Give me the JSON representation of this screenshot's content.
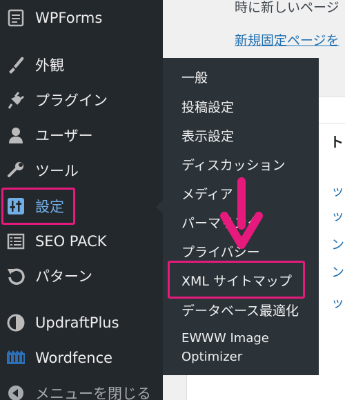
{
  "sidebar": {
    "items": [
      {
        "label": "WPForms",
        "icon": "wpforms-icon"
      },
      {
        "label": "外観",
        "icon": "paintbrush-icon"
      },
      {
        "label": "プラグイン",
        "icon": "plugin-icon"
      },
      {
        "label": "ユーザー",
        "icon": "user-icon"
      },
      {
        "label": "ツール",
        "icon": "wrench-icon"
      },
      {
        "label": "設定",
        "icon": "settings-icon"
      },
      {
        "label": "SEO PACK",
        "icon": "list-icon"
      },
      {
        "label": "パターン",
        "icon": "undo-icon"
      },
      {
        "label": "UpdraftPlus",
        "icon": "updraft-icon"
      },
      {
        "label": "Wordfence",
        "icon": "wordfence-icon"
      }
    ],
    "collapse_label": "メニューを閉じる"
  },
  "submenu": {
    "items": [
      "一般",
      "投稿設定",
      "表示設定",
      "ディスカッション",
      "メディア",
      "パーマリンク",
      "プライバシー",
      "XML サイトマップ",
      "データベース最適化",
      "EWWW Image",
      "Optimizer"
    ]
  },
  "content": {
    "top_text": "時に新しいページ",
    "link_text": "新規固定ページを",
    "panel_title": "ト",
    "fragments": [
      "ッ",
      "ッ",
      "ン",
      "ン",
      "ッ"
    ]
  },
  "colors": {
    "highlight": "#e6197d",
    "sidebar_bg": "#23282d",
    "submenu_bg": "#2c3338",
    "active_text": "#72aee6"
  }
}
